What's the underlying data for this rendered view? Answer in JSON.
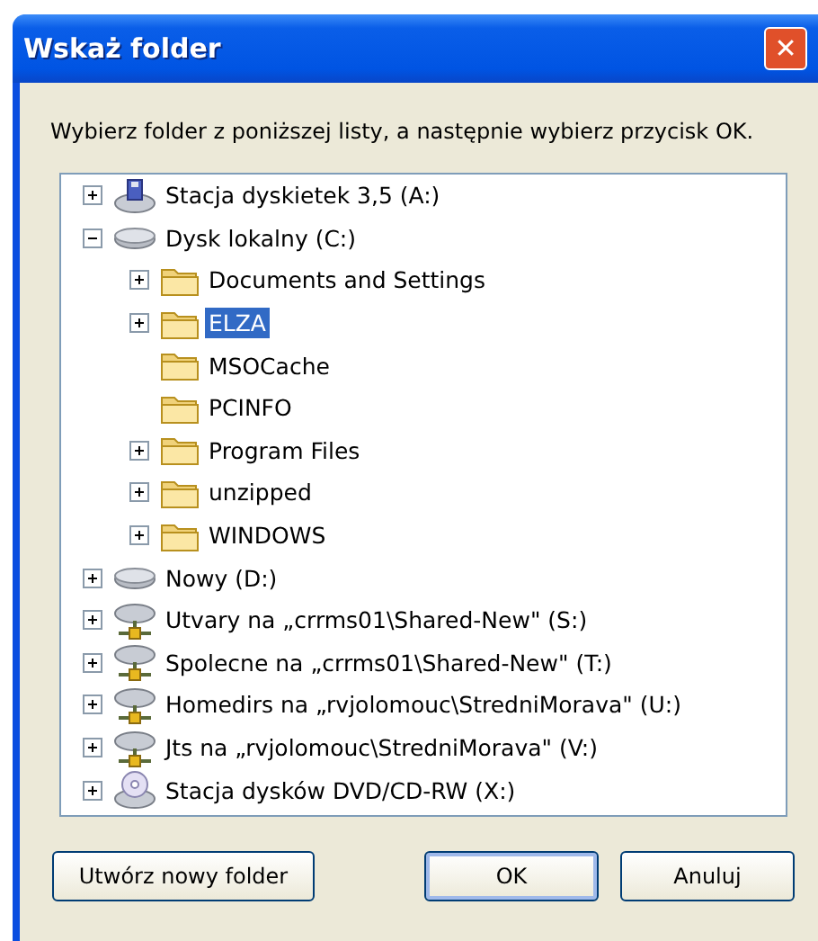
{
  "window": {
    "title": "Wskaż folder",
    "close": "✕"
  },
  "instruction": "Wybierz folder z poniższej listy, a następnie wybierz przycisk OK.",
  "tree": [
    {
      "label": "Stacja dyskietek 3,5 (A:)",
      "kind": "floppy",
      "expandable": true,
      "expanded": false,
      "selected": false
    },
    {
      "label": "Dysk lokalny (C:)",
      "kind": "drive",
      "expandable": true,
      "expanded": true,
      "selected": false,
      "children": [
        {
          "label": "Documents and Settings",
          "kind": "folder",
          "expandable": true,
          "expanded": false,
          "selected": false
        },
        {
          "label": "ELZA",
          "kind": "folder",
          "expandable": true,
          "expanded": false,
          "selected": true
        },
        {
          "label": "MSOCache",
          "kind": "folder",
          "selected": false
        },
        {
          "label": "PCINFO",
          "kind": "folder",
          "selected": false
        },
        {
          "label": "Program Files",
          "kind": "folder",
          "expandable": true,
          "expanded": false,
          "selected": false
        },
        {
          "label": "unzipped",
          "kind": "folder",
          "expandable": true,
          "expanded": false,
          "selected": false
        },
        {
          "label": "WINDOWS",
          "kind": "folder",
          "expandable": true,
          "expanded": false,
          "selected": false
        }
      ]
    },
    {
      "label": "Nowy (D:)",
      "kind": "drive",
      "expandable": true,
      "expanded": false,
      "selected": false
    },
    {
      "label": "Utvary na „crrms01\\Shared-New\" (S:)",
      "kind": "network",
      "expandable": true,
      "expanded": false,
      "selected": false
    },
    {
      "label": "Spolecne na „crrms01\\Shared-New\" (T:)",
      "kind": "network",
      "expandable": true,
      "expanded": false,
      "selected": false
    },
    {
      "label": "Homedirs na „rvjolomouc\\StredniMorava\" (U:)",
      "kind": "network",
      "expandable": true,
      "expanded": false,
      "selected": false
    },
    {
      "label": "Jts na „rvjolomouc\\StredniMorava\" (V:)",
      "kind": "network",
      "expandable": true,
      "expanded": false,
      "selected": false
    },
    {
      "label": "Stacja dysków DVD/CD-RW (X:)",
      "kind": "cdrom",
      "expandable": true,
      "expanded": false,
      "selected": false
    }
  ],
  "buttons": [
    {
      "label": "Utwórz nowy folder",
      "kind": "new"
    },
    {
      "label": "OK",
      "kind": "default"
    },
    {
      "label": "Anuluj",
      "kind": "cancel"
    }
  ]
}
